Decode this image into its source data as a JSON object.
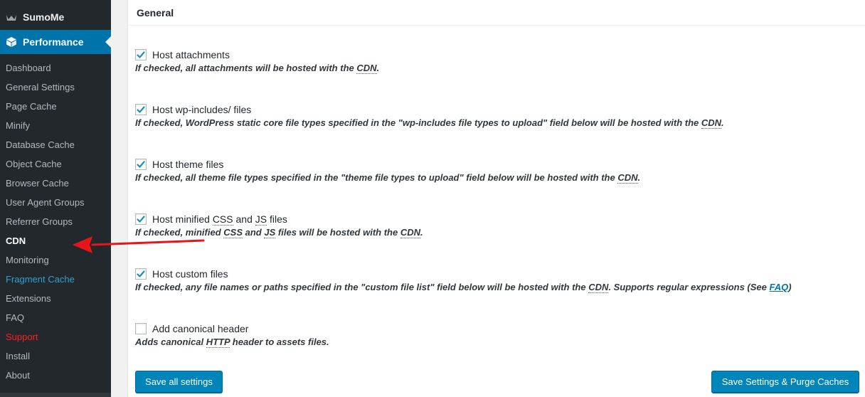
{
  "sidebar": {
    "sumome_label": "SumoMe",
    "performance_label": "Performance",
    "items": [
      {
        "label": "Dashboard"
      },
      {
        "label": "General Settings"
      },
      {
        "label": "Page Cache"
      },
      {
        "label": "Minify"
      },
      {
        "label": "Database Cache"
      },
      {
        "label": "Object Cache"
      },
      {
        "label": "Browser Cache"
      },
      {
        "label": "User Agent Groups"
      },
      {
        "label": "Referrer Groups"
      },
      {
        "label": "CDN",
        "current": true
      },
      {
        "label": "Monitoring"
      },
      {
        "label": "Fragment Cache",
        "color": "#2ea2cc"
      },
      {
        "label": "Extensions"
      },
      {
        "label": "FAQ"
      },
      {
        "label": "Support",
        "color": "#ff1f1f"
      },
      {
        "label": "Install"
      },
      {
        "label": "About"
      }
    ]
  },
  "main": {
    "section_title": "General",
    "options": [
      {
        "label": "Host attachments",
        "checked": true,
        "desc": "If checked, all attachments will be hosted with the",
        "desc_abbr": "CDN",
        "desc_end": "."
      },
      {
        "label": "Host wp-includes/ files",
        "checked": true,
        "desc": "If checked, WordPress static core file types specified in the \"wp-includes file types to upload\" field below will be hosted with the",
        "desc_abbr": "CDN",
        "desc_end": "."
      },
      {
        "label": "Host theme files",
        "checked": true,
        "desc": "If checked, all theme file types specified in the \"theme file types to upload\" field below will be hosted with the",
        "desc_abbr": "CDN",
        "desc_end": "."
      },
      {
        "label_pre": "Host minified",
        "label_abbr1": "CSS",
        "label_mid": "and",
        "label_abbr2": "JS",
        "label_post": "files",
        "checked": true,
        "desc_pre": "If checked, minified",
        "desc_abbr1": "CSS",
        "desc_mid": "and",
        "desc_abbr2": "JS",
        "desc_mid2": "files will be hosted with the",
        "desc_abbr3": "CDN",
        "desc_end": "."
      },
      {
        "label": "Host custom files",
        "checked": true,
        "desc": "If checked, any file names or paths specified in the \"custom file list\" field below will be hosted with the",
        "desc_abbr": "CDN",
        "desc_mid": ". Supports regular expressions (See",
        "desc_link": "FAQ",
        "desc_end": ")"
      },
      {
        "label": "Add canonical header",
        "checked": false,
        "desc_pre": "Adds canonical",
        "desc_abbr": "HTTP",
        "desc_end": "header to assets files."
      }
    ],
    "buttons": {
      "save": "Save all settings",
      "purge": "Save Settings & Purge Caches"
    }
  },
  "colors": {
    "sidebar_bg": "#23282d",
    "active_menu": "#0073aa",
    "button": "#0085ba",
    "arrow": "#e8141b"
  },
  "icons": [
    "crown-icon",
    "cube-icon",
    "checkmark-icon",
    "red-arrow-icon"
  ]
}
